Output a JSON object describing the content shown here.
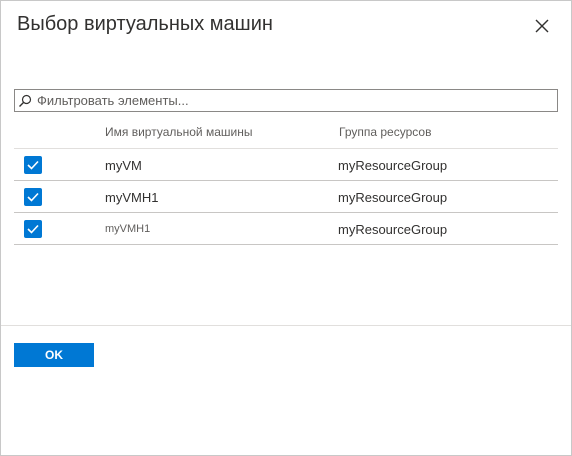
{
  "dialog": {
    "title": "Выбор виртуальных машин",
    "close_icon": "close-icon"
  },
  "filter": {
    "placeholder": "Фильтровать элементы...",
    "value": "",
    "icon": "search-icon"
  },
  "table": {
    "columns": [
      "Имя виртуальной машины",
      "Группа ресурсов"
    ],
    "rows": [
      {
        "checked": true,
        "name": "myVM",
        "resource_group": "myResourceGroup"
      },
      {
        "checked": true,
        "name": "myVMH1",
        "resource_group": "myResourceGroup"
      },
      {
        "checked": true,
        "name": "myVMH1",
        "resource_group": "myResourceGroup"
      }
    ]
  },
  "footer": {
    "ok_label": "OK"
  },
  "colors": {
    "accent": "#0078d4",
    "text": "#323130",
    "muted": "#605e5c",
    "border": "#8a8886"
  }
}
